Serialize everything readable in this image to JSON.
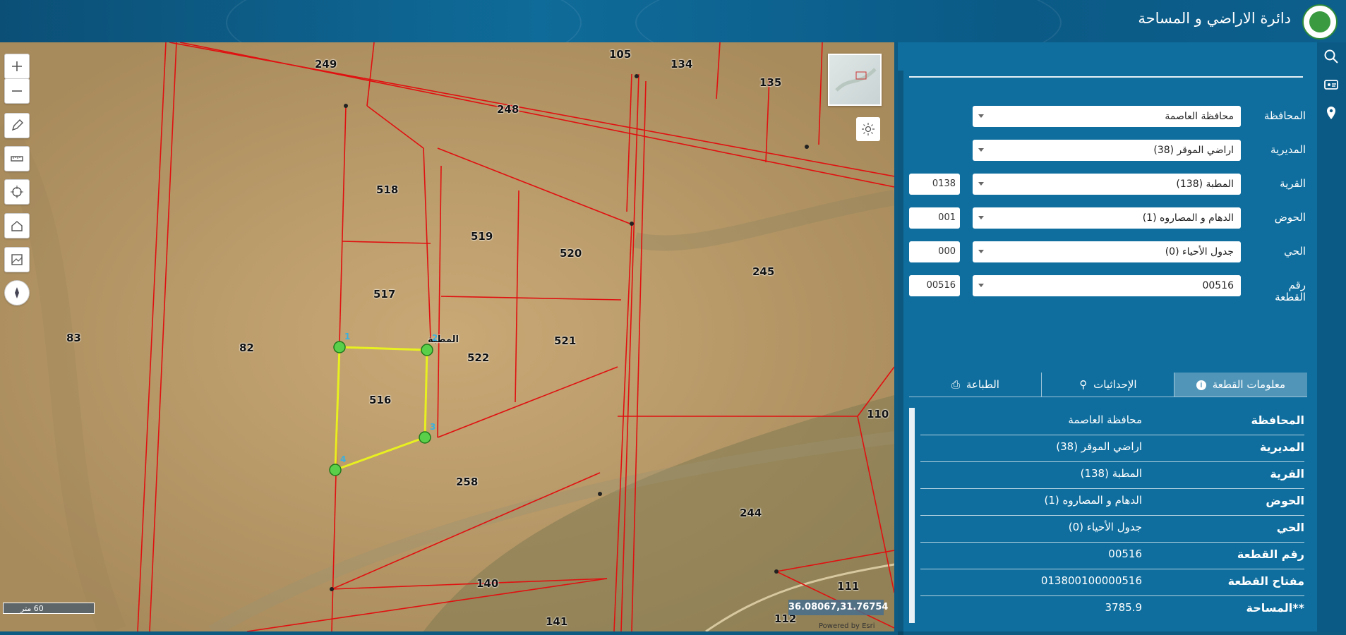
{
  "header": {
    "title": "دائرة الاراضي و المساحة"
  },
  "form": {
    "rows": [
      {
        "label": "المحافظة",
        "value": "محافظة العاصمة",
        "code": ""
      },
      {
        "label": "المديرية",
        "value": "اراضي الموقر (38)",
        "code": ""
      },
      {
        "label": "القرية",
        "value": "المطبة (138)",
        "code": "0138"
      },
      {
        "label": "الحوض",
        "value": "الدهام و المصاروه (1)",
        "code": "001"
      },
      {
        "label": "الحي",
        "value": "جدول الأحياء (0)",
        "code": "000"
      },
      {
        "label": "رقم القطعة",
        "value": "00516",
        "code": "00516"
      }
    ]
  },
  "tabs": [
    {
      "label": "معلومات القطعة",
      "icon": "info-icon"
    },
    {
      "label": "الإحداثيات",
      "icon": "person-pin-icon"
    },
    {
      "label": "الطباعة",
      "icon": "printer-icon"
    }
  ],
  "info": {
    "rows": [
      {
        "key": "المحافظة",
        "value": "محافظة العاصمة"
      },
      {
        "key": "المديرية",
        "value": "اراضي الموقر (38)"
      },
      {
        "key": "القرية",
        "value": "المطبة (138)"
      },
      {
        "key": "الحوض",
        "value": "الدهام و المصاروه (1)"
      },
      {
        "key": "الحي",
        "value": "جدول الأحياء (0)"
      },
      {
        "key": "رقم القطعة",
        "value": "00516"
      },
      {
        "key": "مفتاح القطعة",
        "value": "013800100000516"
      },
      {
        "key": "**المساحة",
        "value": "3785.9"
      }
    ]
  },
  "map": {
    "parcel_labels": [
      "249",
      "105",
      "134",
      "135",
      "248",
      "518",
      "519",
      "520",
      "245",
      "517",
      "83",
      "82",
      "522",
      "521",
      "516",
      "110",
      "258",
      "244",
      "140",
      "111",
      "141",
      "112"
    ],
    "vertex_numbers": [
      "1",
      "2",
      "3",
      "4"
    ],
    "village_label": "المطبة",
    "scale_text": "60 متر",
    "coordinates": "36.08067,31.76754",
    "attribution": "Powered by Esri"
  },
  "rail": {
    "icons": [
      "search-icon",
      "id-card-icon",
      "location-pin-icon"
    ]
  }
}
